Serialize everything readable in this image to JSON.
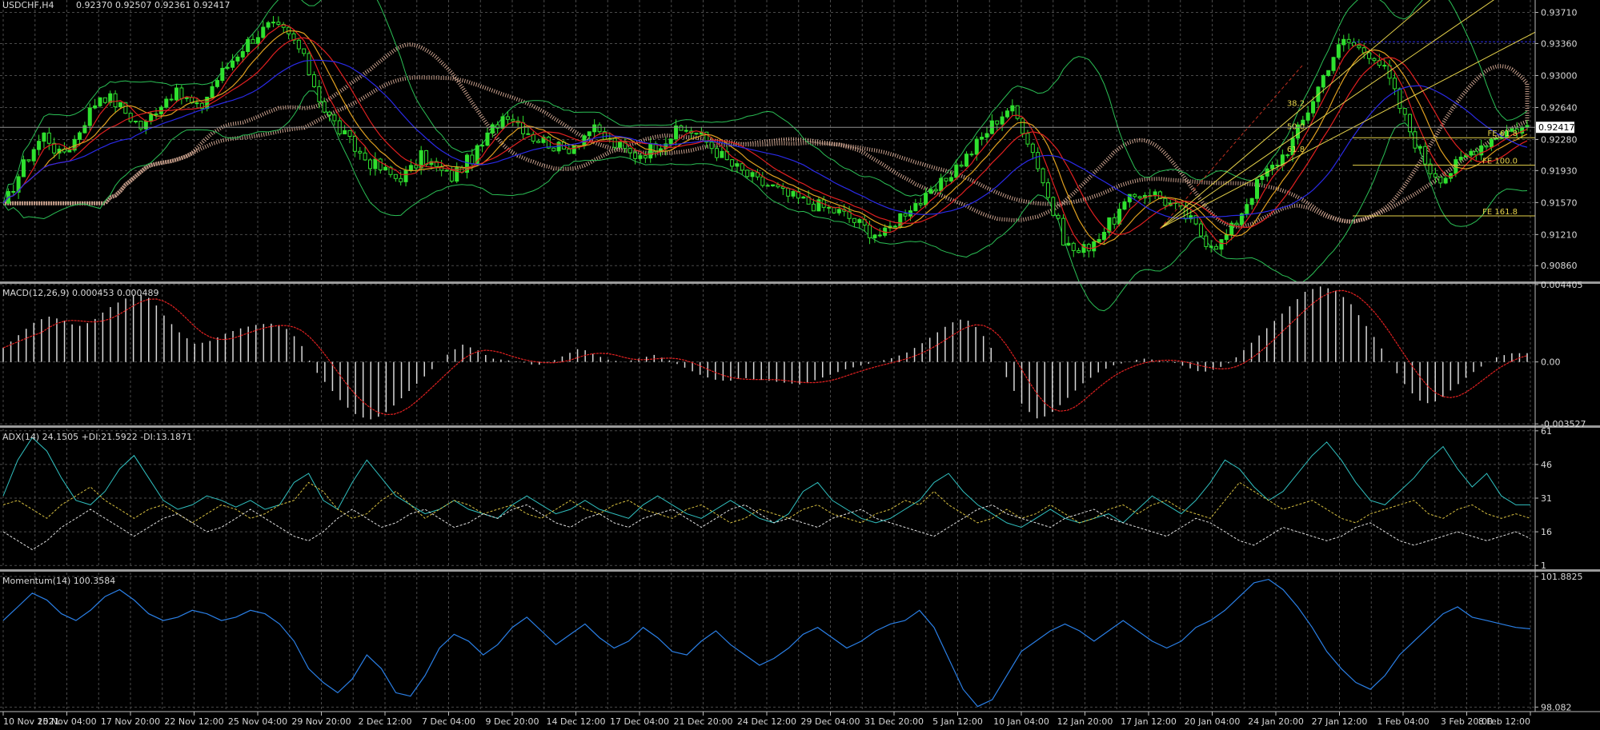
{
  "colors": {
    "background": "#000000",
    "grid": "#4a4a4a",
    "text": "#d8d8d8",
    "bull_candle": "#2fe02f",
    "bear_candle": "#2fe02f",
    "bollinger": "#2bbf55",
    "ma_red": "#e02020",
    "ma_blue": "#2a2ae6",
    "ma_orange": "#e0a020",
    "ichimoku_cloud": "#f0c0a8",
    "macd_hist": "#d8d8d8",
    "macd_signal": "#e02020",
    "adx_main": "#30c0c0",
    "adx_plus": "#d8c040",
    "adx_minus": "#e0e0e0",
    "momentum": "#2a7fe6",
    "fib": "#e6d24a",
    "hline_blue": "#2a2ae6",
    "price_line": "#909090"
  },
  "chart_data": [
    {
      "type": "candlestick",
      "title": "USDCHF,H4",
      "ohlc_text": "0.92370 0.92507 0.92361 0.92417",
      "current_price_label": "0.92417",
      "current_price": 0.92417,
      "ylim": [
        0.907,
        0.9385
      ],
      "y_ticks": [
        "0.93710",
        "0.93360",
        "0.93000",
        "0.92640",
        "0.92280",
        "0.91930",
        "0.91570",
        "0.91210",
        "0.90860"
      ],
      "y_tick_values": [
        0.9371,
        0.9336,
        0.93,
        0.9264,
        0.9228,
        0.9193,
        0.9157,
        0.9121,
        0.9086
      ],
      "close_path": [
        0.915,
        0.9185,
        0.9215,
        0.9235,
        0.921,
        0.9225,
        0.9255,
        0.928,
        0.927,
        0.9255,
        0.924,
        0.9265,
        0.928,
        0.9275,
        0.926,
        0.929,
        0.931,
        0.933,
        0.9345,
        0.9355,
        0.935,
        0.9335,
        0.93,
        0.926,
        0.924,
        0.922,
        0.9205,
        0.9195,
        0.9185,
        0.919,
        0.921,
        0.9195,
        0.9185,
        0.92,
        0.9215,
        0.924,
        0.926,
        0.9245,
        0.923,
        0.9225,
        0.9215,
        0.9225,
        0.924,
        0.923,
        0.922,
        0.921,
        0.9215,
        0.9225,
        0.9235,
        0.924,
        0.923,
        0.9215,
        0.92,
        0.919,
        0.918,
        0.9175,
        0.9165,
        0.916,
        0.9155,
        0.915,
        0.9145,
        0.9135,
        0.9125,
        0.912,
        0.914,
        0.9155,
        0.916,
        0.9175,
        0.9195,
        0.921,
        0.923,
        0.925,
        0.9265,
        0.924,
        0.92,
        0.915,
        0.911,
        0.91,
        0.9115,
        0.913,
        0.915,
        0.9165,
        0.917,
        0.916,
        0.915,
        0.9135,
        0.9115,
        0.911,
        0.913,
        0.916,
        0.9185,
        0.92,
        0.922,
        0.925,
        0.9285,
        0.932,
        0.934,
        0.933,
        0.9325,
        0.93,
        0.926,
        0.9225,
        0.9195,
        0.9185,
        0.92,
        0.9215,
        0.9225,
        0.9235,
        0.924,
        0.9242
      ],
      "hlines": [
        {
          "price": 0.9338,
          "color": "blue"
        },
        {
          "price": 0.923,
          "label": "FE 61.8"
        },
        {
          "price": 0.9199,
          "label": "FE 100.0"
        },
        {
          "price": 0.9142,
          "label": "FE 161.8"
        }
      ],
      "fib_labels": [
        "38.2",
        "50.0",
        "61.8"
      ],
      "fan_levels": [
        0.382,
        0.5,
        0.618
      ]
    },
    {
      "type": "histogram",
      "title": "MACD(12,26,9) 0.000453 0.000489",
      "ylim": [
        -0.00352,
        0.0044
      ],
      "y_ticks": [
        "0.004405",
        "0.00",
        "-0.003527"
      ],
      "y_tick_values": [
        0.004405,
        0.0,
        -0.003527
      ],
      "values": [
        0.0008,
        0.0015,
        0.0022,
        0.0026,
        0.0024,
        0.002,
        0.0023,
        0.003,
        0.0035,
        0.0039,
        0.0036,
        0.0025,
        0.0016,
        0.001,
        0.0012,
        0.0016,
        0.0019,
        0.0021,
        0.0022,
        0.002,
        0.0012,
        -0.0004,
        -0.0014,
        -0.0024,
        -0.0031,
        -0.0033,
        -0.0028,
        -0.002,
        -0.0012,
        -0.0004,
        0.0004,
        0.001,
        0.0007,
        0.0002,
        0.0001,
        0.0,
        -0.0002,
        0.0,
        0.0004,
        0.0008,
        0.0004,
        0.0001,
        0.0,
        0.0002,
        0.0004,
        0.0001,
        -0.0003,
        -0.0007,
        -0.001,
        -0.0011,
        -0.0009,
        -0.001,
        -0.0011,
        -0.0012,
        -0.0013,
        -0.001,
        -0.0007,
        -0.0004,
        -0.0002,
        0.0,
        0.0002,
        0.0005,
        0.001,
        0.0016,
        0.0022,
        0.0025,
        0.0018,
        0.0005,
        -0.0012,
        -0.0026,
        -0.0033,
        -0.0028,
        -0.002,
        -0.0012,
        -0.0006,
        -0.0002,
        0.0,
        0.0002,
        0.0001,
        0.0,
        -0.0003,
        -0.0006,
        -0.0004,
        0.0,
        0.0008,
        0.0016,
        0.0024,
        0.0032,
        0.004,
        0.0043,
        0.0041,
        0.0034,
        0.0022,
        0.001,
        -0.0004,
        -0.0016,
        -0.0024,
        -0.0022,
        -0.0015,
        -0.0008,
        -0.0002,
        0.0003,
        0.0005,
        0.0005
      ]
    },
    {
      "type": "line",
      "title": "ADX(14) 24.1505 +DI:21.5922 -DI:13.1871",
      "ylim": [
        0,
        62
      ],
      "y_ticks": [
        "61",
        "46",
        "31",
        "16",
        "1"
      ],
      "y_tick_values": [
        61,
        46,
        31,
        16,
        1
      ],
      "series": [
        {
          "values": [
            32,
            48,
            58,
            52,
            40,
            30,
            28,
            34,
            44,
            50,
            40,
            30,
            26,
            28,
            32,
            30,
            27,
            30,
            26,
            28,
            38,
            42,
            30,
            26,
            38,
            48,
            40,
            32,
            28,
            24,
            26,
            30,
            26,
            24,
            22,
            28,
            32,
            28,
            24,
            26,
            30,
            26,
            24,
            22,
            28,
            32,
            28,
            24,
            22,
            26,
            30,
            26,
            22,
            20,
            24,
            34,
            38,
            30,
            26,
            22,
            20,
            22,
            26,
            30,
            38,
            42,
            34,
            28,
            24,
            20,
            18,
            22,
            26,
            22,
            20,
            22,
            24,
            20,
            26,
            32,
            28,
            24,
            30,
            38,
            48,
            44,
            36,
            30,
            34,
            42,
            50,
            56,
            48,
            38,
            30,
            28,
            34,
            40,
            48,
            54,
            44,
            36,
            42,
            32,
            28,
            28
          ]
        },
        {
          "values": [
            28,
            30,
            26,
            22,
            28,
            32,
            36,
            30,
            26,
            22,
            26,
            28,
            24,
            20,
            24,
            28,
            26,
            22,
            24,
            28,
            30,
            38,
            34,
            26,
            22,
            24,
            30,
            34,
            28,
            22,
            26,
            30,
            28,
            24,
            26,
            28,
            24,
            22,
            26,
            30,
            26,
            24,
            28,
            30,
            26,
            24,
            22,
            26,
            28,
            24,
            20,
            22,
            26,
            24,
            22,
            26,
            28,
            24,
            22,
            20,
            24,
            26,
            30,
            28,
            34,
            28,
            24,
            20,
            22,
            26,
            22,
            24,
            28,
            24,
            20,
            22,
            26,
            28,
            24,
            28,
            30,
            26,
            24,
            22,
            30,
            38,
            34,
            30,
            26,
            28,
            30,
            26,
            22,
            20,
            24,
            26,
            28,
            30,
            24,
            22,
            26,
            28,
            24,
            22,
            24,
            22
          ]
        },
        {
          "values": [
            16,
            12,
            8,
            12,
            18,
            22,
            26,
            22,
            18,
            14,
            18,
            22,
            24,
            20,
            16,
            18,
            22,
            26,
            22,
            18,
            14,
            12,
            16,
            22,
            26,
            22,
            18,
            20,
            24,
            26,
            22,
            18,
            20,
            24,
            22,
            26,
            28,
            24,
            20,
            18,
            22,
            24,
            20,
            18,
            22,
            24,
            26,
            22,
            18,
            22,
            26,
            28,
            24,
            20,
            22,
            20,
            18,
            22,
            24,
            26,
            22,
            20,
            18,
            16,
            14,
            18,
            22,
            26,
            28,
            24,
            22,
            20,
            18,
            22,
            24,
            26,
            22,
            20,
            18,
            16,
            14,
            18,
            22,
            20,
            16,
            12,
            10,
            14,
            18,
            16,
            14,
            12,
            14,
            18,
            20,
            16,
            12,
            10,
            12,
            14,
            16,
            14,
            12,
            14,
            16,
            13
          ]
        }
      ]
    },
    {
      "type": "line",
      "title": "Momentum(14) 100.3584",
      "ylim": [
        97.95,
        102.0
      ],
      "y_ticks": [
        "101.8825",
        "98.082"
      ],
      "y_tick_values": [
        101.8825,
        98.082
      ],
      "series": [
        {
          "values": [
            100.6,
            101.0,
            101.4,
            101.2,
            100.8,
            100.6,
            100.9,
            101.3,
            101.5,
            101.2,
            100.8,
            100.6,
            100.7,
            100.9,
            100.8,
            100.6,
            100.7,
            100.9,
            100.8,
            100.5,
            100.0,
            99.2,
            98.8,
            98.5,
            98.9,
            99.6,
            99.2,
            98.5,
            98.4,
            99.0,
            99.8,
            100.2,
            100.0,
            99.6,
            99.9,
            100.4,
            100.7,
            100.3,
            99.9,
            100.2,
            100.5,
            100.1,
            99.8,
            100.0,
            100.4,
            100.1,
            99.7,
            99.6,
            100.0,
            100.3,
            99.9,
            99.6,
            99.3,
            99.5,
            99.8,
            100.2,
            100.4,
            100.1,
            99.8,
            100.0,
            100.3,
            100.5,
            100.6,
            100.9,
            100.4,
            99.5,
            98.6,
            98.1,
            98.3,
            99.0,
            99.7,
            100.0,
            100.3,
            100.5,
            100.3,
            100.0,
            100.3,
            100.6,
            100.3,
            100.0,
            99.8,
            100.0,
            100.4,
            100.6,
            100.9,
            101.3,
            101.7,
            101.8,
            101.5,
            101.0,
            100.4,
            99.7,
            99.2,
            98.8,
            98.6,
            99.0,
            99.6,
            100.0,
            100.4,
            100.8,
            101.0,
            100.7,
            100.6,
            100.5,
            100.4,
            100.36
          ]
        }
      ]
    }
  ],
  "x_ticks": [
    "10 Nov 2021",
    "15 Nov 04:00",
    "17 Nov 20:00",
    "22 Nov 12:00",
    "25 Nov 04:00",
    "29 Nov 20:00",
    "2 Dec 12:00",
    "7 Dec 04:00",
    "9 Dec 20:00",
    "14 Dec 12:00",
    "17 Dec 04:00",
    "21 Dec 20:00",
    "24 Dec 12:00",
    "29 Dec 04:00",
    "31 Dec 20:00",
    "5 Jan 12:00",
    "10 Jan 04:00",
    "12 Jan 20:00",
    "17 Jan 12:00",
    "20 Jan 04:00",
    "24 Jan 20:00",
    "27 Jan 12:00",
    "1 Feb 04:00",
    "3 Feb 20:00",
    "8 Feb 12:00"
  ]
}
